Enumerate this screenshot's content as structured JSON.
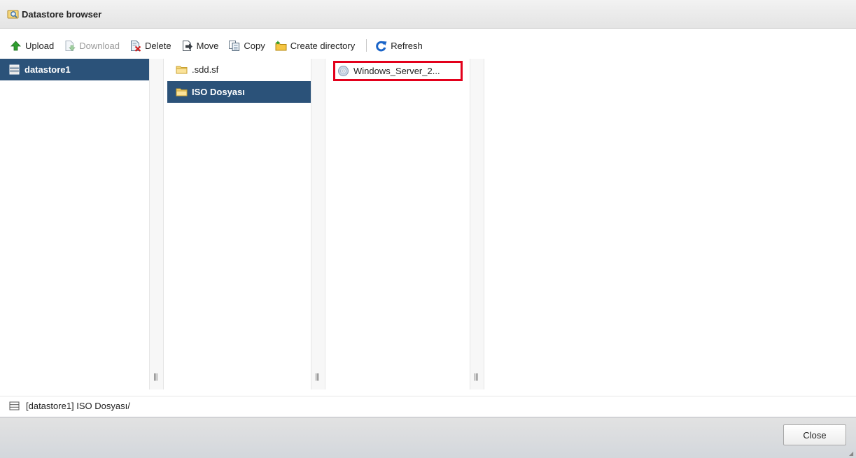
{
  "window": {
    "title": "Datastore browser",
    "icon": "datastore-browser-icon"
  },
  "toolbar": {
    "upload_label": "Upload",
    "download_label": "Download",
    "delete_label": "Delete",
    "move_label": "Move",
    "copy_label": "Copy",
    "create_directory_label": "Create directory",
    "refresh_label": "Refresh"
  },
  "panes": {
    "datastores": [
      {
        "label": "datastore1",
        "icon": "datastore-icon",
        "selected": true
      }
    ],
    "folders": [
      {
        "label": ".sdd.sf",
        "icon": "folder-icon",
        "selected": false
      },
      {
        "label": "ISO Dosyası",
        "icon": "folder-icon",
        "selected": true
      }
    ],
    "files": [
      {
        "label": "Windows_Server_2...",
        "icon": "iso-disc-icon",
        "highlighted": true
      }
    ]
  },
  "status": {
    "path": "[datastore1] ISO Dosyası/"
  },
  "footer": {
    "close_label": "Close"
  },
  "colors": {
    "selection": "#2b5279",
    "highlight_border": "#e3001b",
    "refresh_accent": "#1a64c8",
    "upload_accent": "#2e9e2e"
  }
}
